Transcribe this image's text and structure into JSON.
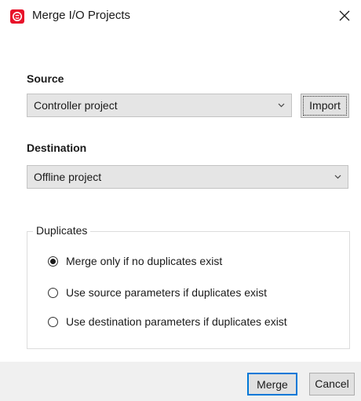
{
  "window": {
    "title": "Merge I/O Projects",
    "app_icon": "rockwell-logo-icon",
    "close_icon": "close-icon",
    "accent": "#e8122a"
  },
  "source": {
    "label": "Source",
    "selected": "Controller project",
    "import_label": "Import"
  },
  "destination": {
    "label": "Destination",
    "selected": "Offline project"
  },
  "duplicates": {
    "label": "Duplicates",
    "options": [
      {
        "label": "Merge only if no duplicates exist",
        "selected": true
      },
      {
        "label": "Use source parameters if duplicates exist",
        "selected": false
      },
      {
        "label": "Use destination parameters if duplicates exist",
        "selected": false
      }
    ]
  },
  "footer": {
    "merge_label": "Merge",
    "cancel_label": "Cancel",
    "default_button_color": "#0078d7"
  }
}
